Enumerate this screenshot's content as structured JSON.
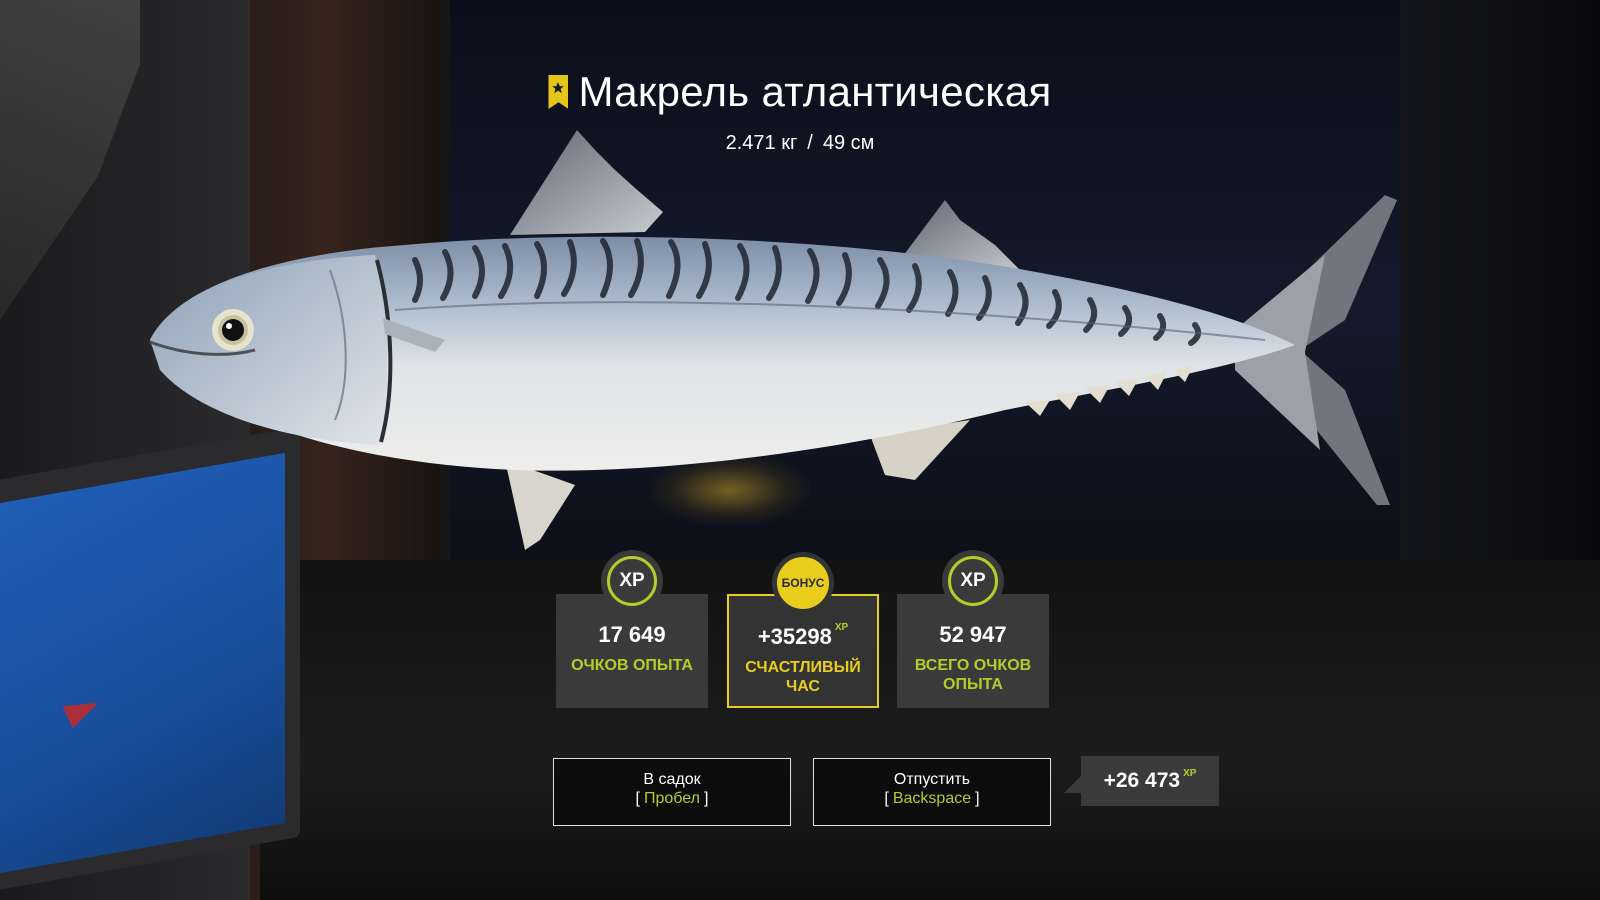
{
  "fish": {
    "name": "Макрель атлантическая",
    "weight": "2.471 кг",
    "separator": "/",
    "length": "49 см",
    "trophy_marker_color": "#e6c619"
  },
  "xp_cards": [
    {
      "badge": "XP",
      "value": "17 649",
      "value_suffix": "",
      "label": "ОЧКОВ ОПЫТА"
    },
    {
      "badge": "БОНУС",
      "value": "+35298",
      "value_suffix": "XP",
      "label": "СЧАСТЛИВЫЙ ЧАС"
    },
    {
      "badge": "XP",
      "value": "52 947",
      "value_suffix": "",
      "label": "ВСЕГО ОЧКОВ ОПЫТА"
    }
  ],
  "buttons": {
    "keep": {
      "label": "В садок",
      "key_open": "[",
      "key": "Пробел",
      "key_close": "]"
    },
    "release": {
      "label": "Отпустить",
      "key_open": "[",
      "key": "Backspace",
      "key_close": "]"
    }
  },
  "release_xp": {
    "value": "+26 473",
    "suffix": "XP"
  },
  "colors": {
    "accent_green": "#b6cc2a",
    "accent_yellow": "#e8cd1c",
    "card_bg": "#3a3a3a"
  }
}
